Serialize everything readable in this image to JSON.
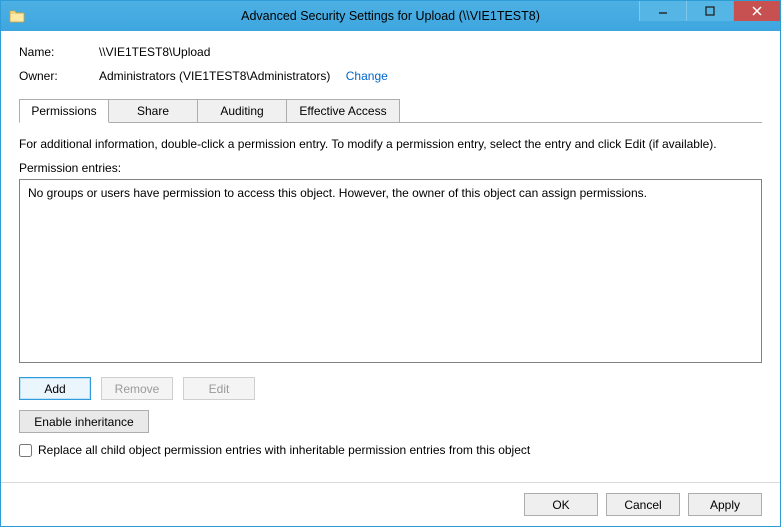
{
  "window": {
    "title": "Advanced Security Settings for Upload (\\\\VIE1TEST8)"
  },
  "fields": {
    "name_label": "Name:",
    "name_value": "\\\\VIE1TEST8\\Upload",
    "owner_label": "Owner:",
    "owner_value": "Administrators (VIE1TEST8\\Administrators)",
    "change_link": "Change"
  },
  "tabs": {
    "permissions": "Permissions",
    "share": "Share",
    "auditing": "Auditing",
    "effective": "Effective Access"
  },
  "body": {
    "instructions": "For additional information, double-click a permission entry. To modify a permission entry, select the entry and click Edit (if available).",
    "entries_label": "Permission entries:",
    "empty_message": "No groups or users have permission to access this object. However, the owner of this object can assign permissions."
  },
  "buttons": {
    "add": "Add",
    "remove": "Remove",
    "edit": "Edit",
    "enable_inheritance": "Enable inheritance",
    "ok": "OK",
    "cancel": "Cancel",
    "apply": "Apply"
  },
  "checkbox": {
    "replace_label": "Replace all child object permission entries with inheritable permission entries from this object"
  }
}
